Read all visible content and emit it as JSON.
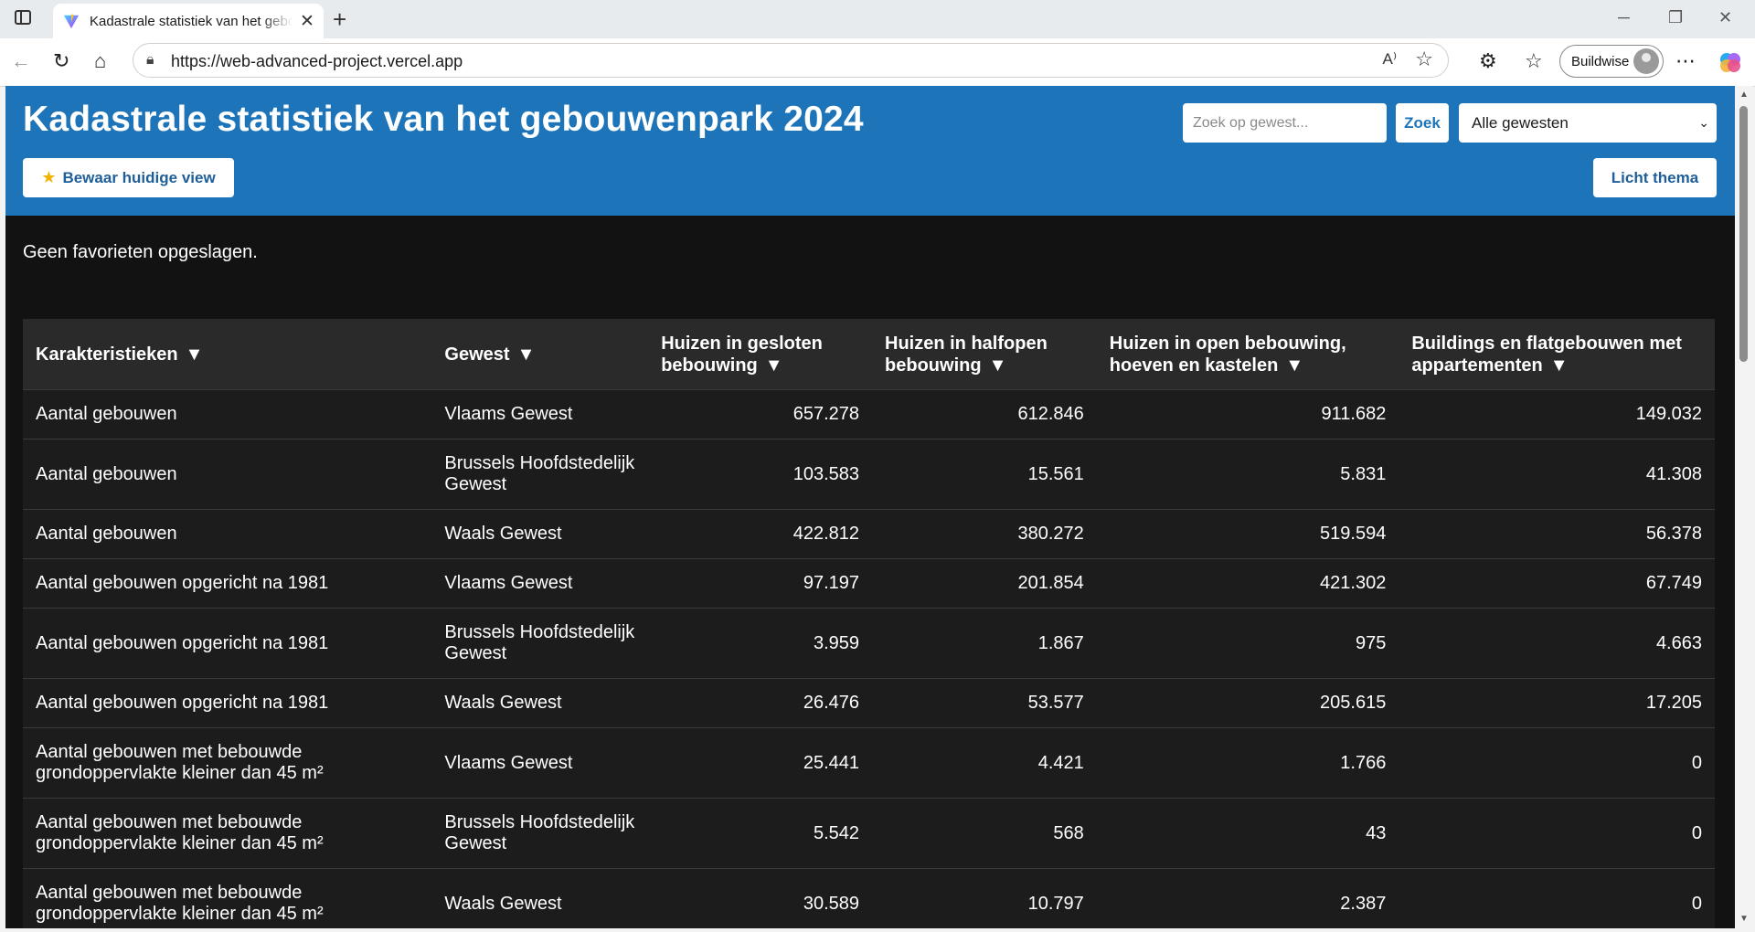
{
  "browser": {
    "tab_title": "Kadastrale statistiek van het gebouwenpark 2024",
    "url": "https://web-advanced-project.vercel.app",
    "profile_name": "Buildwise"
  },
  "header": {
    "title": "Kadastrale statistiek van het gebouwenpark 2024",
    "search_placeholder": "Zoek op gewest...",
    "search_button": "Zoek",
    "region_selected": "Alle gewesten",
    "save_view_button": "Bewaar huidige view",
    "theme_button": "Licht thema",
    "accent_color": "#1e74b8"
  },
  "favorites": {
    "empty_message": "Geen favorieten opgeslagen."
  },
  "table": {
    "sort_arrow": "▼",
    "columns": [
      {
        "label": "Karakteristieken"
      },
      {
        "label": "Gewest"
      },
      {
        "label": "Huizen in gesloten bebouwing"
      },
      {
        "label": "Huizen in halfopen bebouwing"
      },
      {
        "label": "Huizen in open bebouwing, hoeven en kastelen"
      },
      {
        "label": "Buildings en flatgebouwen met appartementen"
      }
    ],
    "rows": [
      {
        "k": "Aantal gebouwen",
        "g": "Vlaams Gewest",
        "v1": "657.278",
        "v2": "612.846",
        "v3": "911.682",
        "v4": "149.032"
      },
      {
        "k": "Aantal gebouwen",
        "g": "Brussels Hoofdstedelijk Gewest",
        "v1": "103.583",
        "v2": "15.561",
        "v3": "5.831",
        "v4": "41.308"
      },
      {
        "k": "Aantal gebouwen",
        "g": "Waals Gewest",
        "v1": "422.812",
        "v2": "380.272",
        "v3": "519.594",
        "v4": "56.378"
      },
      {
        "k": "Aantal gebouwen opgericht na 1981",
        "g": "Vlaams Gewest",
        "v1": "97.197",
        "v2": "201.854",
        "v3": "421.302",
        "v4": "67.749"
      },
      {
        "k": "Aantal gebouwen opgericht na 1981",
        "g": "Brussels Hoofdstedelijk Gewest",
        "v1": "3.959",
        "v2": "1.867",
        "v3": "975",
        "v4": "4.663"
      },
      {
        "k": "Aantal gebouwen opgericht na 1981",
        "g": "Waals Gewest",
        "v1": "26.476",
        "v2": "53.577",
        "v3": "205.615",
        "v4": "17.205"
      },
      {
        "k": "Aantal gebouwen met bebouwde grondoppervlakte kleiner dan 45 m²",
        "g": "Vlaams Gewest",
        "v1": "25.441",
        "v2": "4.421",
        "v3": "1.766",
        "v4": "0"
      },
      {
        "k": "Aantal gebouwen met bebouwde grondoppervlakte kleiner dan 45 m²",
        "g": "Brussels Hoofdstedelijk Gewest",
        "v1": "5.542",
        "v2": "568",
        "v3": "43",
        "v4": "0"
      },
      {
        "k": "Aantal gebouwen met bebouwde grondoppervlakte kleiner dan 45 m²",
        "g": "Waals Gewest",
        "v1": "30.589",
        "v2": "10.797",
        "v3": "2.387",
        "v4": "0"
      }
    ]
  }
}
